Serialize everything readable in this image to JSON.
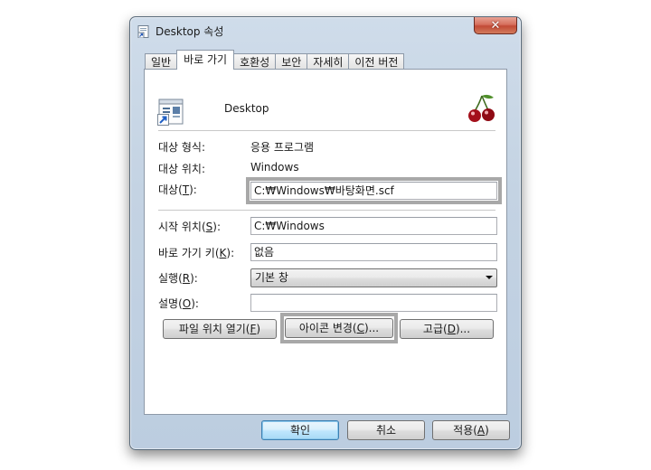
{
  "window": {
    "title": "Desktop 속성",
    "close_glyph": "✕"
  },
  "tabs": [
    {
      "label": "일반",
      "active": false
    },
    {
      "label": "바로 가기",
      "active": true
    },
    {
      "label": "호환성",
      "active": false
    },
    {
      "label": "보안",
      "active": false
    },
    {
      "label": "자세히",
      "active": false
    },
    {
      "label": "이전 버전",
      "active": false
    }
  ],
  "header": {
    "name": "Desktop",
    "icon": "shortcut-file-icon",
    "app_logo": "cherry-logo-icon"
  },
  "info": {
    "target_type_label": "대상 형식:",
    "target_type_value": "응용 프로그램",
    "target_location_label": "대상 위치:",
    "target_location_value": "Windows"
  },
  "fields": {
    "target_label": "대상(",
    "target_key": "T",
    "target_label_end": "):",
    "target_value": "C:₩Windows₩바탕화면.scf",
    "start_in_label": "시작 위치(",
    "start_in_key": "S",
    "start_in_label_end": "):",
    "start_in_value": "C:₩Windows",
    "shortcut_key_label": "바로 가기 키(",
    "shortcut_key_key": "K",
    "shortcut_key_label_end": "):",
    "shortcut_key_value": "없음",
    "run_label": "실행(",
    "run_key": "R",
    "run_label_end": "):",
    "run_value": "기본 창",
    "comment_label": "설명(",
    "comment_key": "O",
    "comment_label_end": "):",
    "comment_value": ""
  },
  "actions": {
    "open_location_text": "파일 위치 열기(",
    "open_location_key": "F",
    "open_location_end": ")",
    "change_icon_text": "아이콘 변경(",
    "change_icon_key": "C",
    "change_icon_end": ")...",
    "advanced_text": "고급(",
    "advanced_key": "D",
    "advanced_end": ")..."
  },
  "footer": {
    "ok_label": "확인",
    "cancel_label": "취소",
    "apply_text": "적용(",
    "apply_key": "A",
    "apply_end": ")"
  },
  "colors": {
    "frame": "#c4d3e3",
    "default_button": "#bee6fd",
    "close_button": "#c24a36"
  }
}
